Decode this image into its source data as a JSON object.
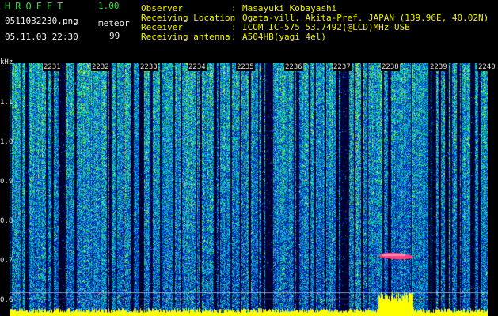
{
  "header": {
    "app_title": "HROFFT",
    "app_version": "1.00",
    "file_name": "0511032230.png",
    "date_time": "05.11.03 22:30",
    "meteor_label": "meteor",
    "meteor_count": "99"
  },
  "info": [
    {
      "label": "Observer",
      "value": "Masayuki Kobayashi"
    },
    {
      "label": "Receiving Location",
      "value": "Ogata-vill. Akita-Pref. JAPAN (139.96E, 40.02N)"
    },
    {
      "label": "Receiver",
      "value": "ICOM IC-575 53.7492(@LCD)MHz USB"
    },
    {
      "label": "Receiving antenna",
      "value": "A504HB(yagi 4el)"
    }
  ],
  "axis": {
    "unit": "kHz",
    "freq_ticks": [
      "1.1",
      "1.0",
      "0.9",
      "0.8",
      "0.7",
      "0.6"
    ],
    "time_ticks": [
      "2231",
      "2232",
      "2233",
      "2234",
      "2235",
      "2236",
      "2237",
      "2238",
      "2239",
      "2240"
    ]
  },
  "colors": {
    "background": "#000000",
    "header_green": "#32e032",
    "header_white": "#f0f0f0",
    "header_yellow": "#f0f000",
    "meteor_echo": "#ff4080",
    "signal_bar": "#ffff00"
  }
}
